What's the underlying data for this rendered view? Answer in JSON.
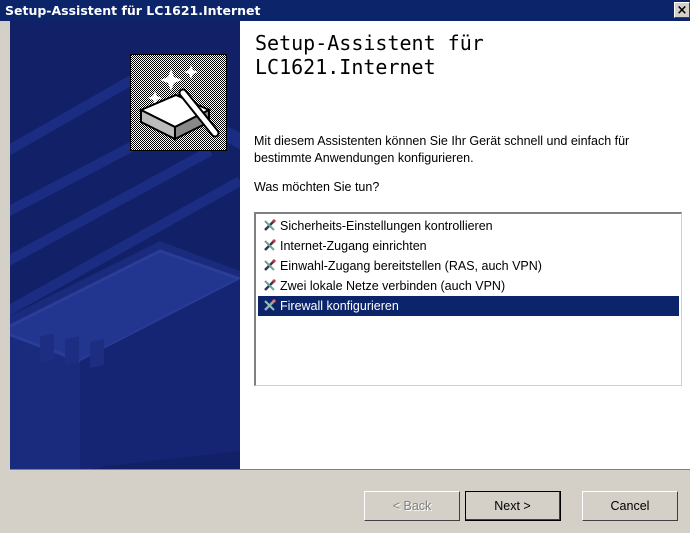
{
  "window": {
    "title": "Setup-Assistent für LC1621.Internet",
    "close_label": "×"
  },
  "content": {
    "heading_line1": "Setup-Assistent für",
    "heading_line2": "LC1621.Internet",
    "description": "Mit diesem Assistenten können Sie Ihr Gerät schnell und einfach für bestimmte Anwendungen konfigurieren.",
    "question": "Was möchten Sie tun?",
    "options": [
      {
        "label": "Sicherheits-Einstellungen kontrollieren",
        "selected": false
      },
      {
        "label": "Internet-Zugang einrichten",
        "selected": false
      },
      {
        "label": "Einwahl-Zugang bereitstellen (RAS, auch VPN)",
        "selected": false
      },
      {
        "label": "Zwei lokale Netze verbinden (auch VPN)",
        "selected": false
      },
      {
        "label": "Firewall konfigurieren",
        "selected": true
      }
    ]
  },
  "buttons": {
    "back": "< Back",
    "next": "Next >",
    "cancel": "Cancel"
  },
  "icons": {
    "wizard": "wizard-wand-icon",
    "list_item": "wizard-tool-icon"
  },
  "colors": {
    "titlebar": "#0b246a",
    "side_panel": "#122068",
    "selection": "#0b246a",
    "dialog_face": "#d4d0c8"
  }
}
